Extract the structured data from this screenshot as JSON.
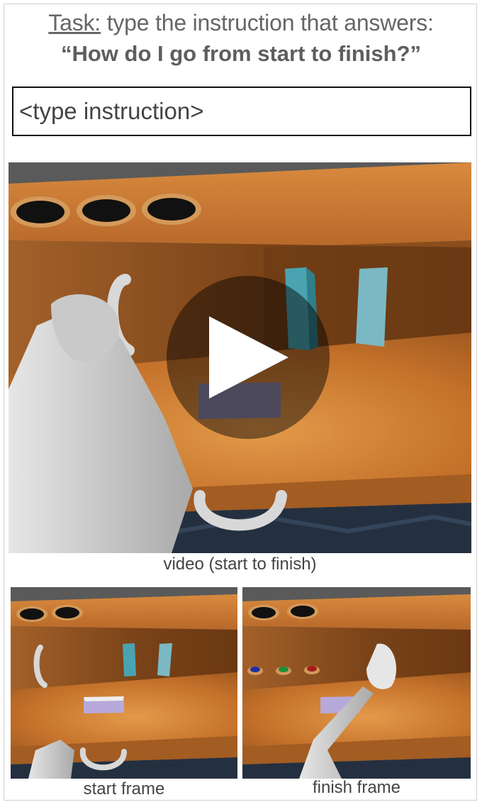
{
  "task": {
    "prefix": "Task:",
    "text": " type the instruction that answers:",
    "question": "“How do I go from start to finish?”"
  },
  "instruction_input": {
    "value": "",
    "placeholder": "<type instruction>"
  },
  "media": {
    "video_caption": "video (start to finish)",
    "start_caption": "start frame",
    "finish_caption": "finish frame"
  },
  "colors": {
    "wood": "#c9782e",
    "wood_dark": "#8f4f1c",
    "block_teal": "#5fbcc8",
    "block_lavender": "#b7a9d9",
    "button_blue": "#1f2fa0",
    "button_green": "#1e8f3a",
    "button_red": "#a61c1c"
  },
  "icons": {
    "play": "play-triangle"
  }
}
